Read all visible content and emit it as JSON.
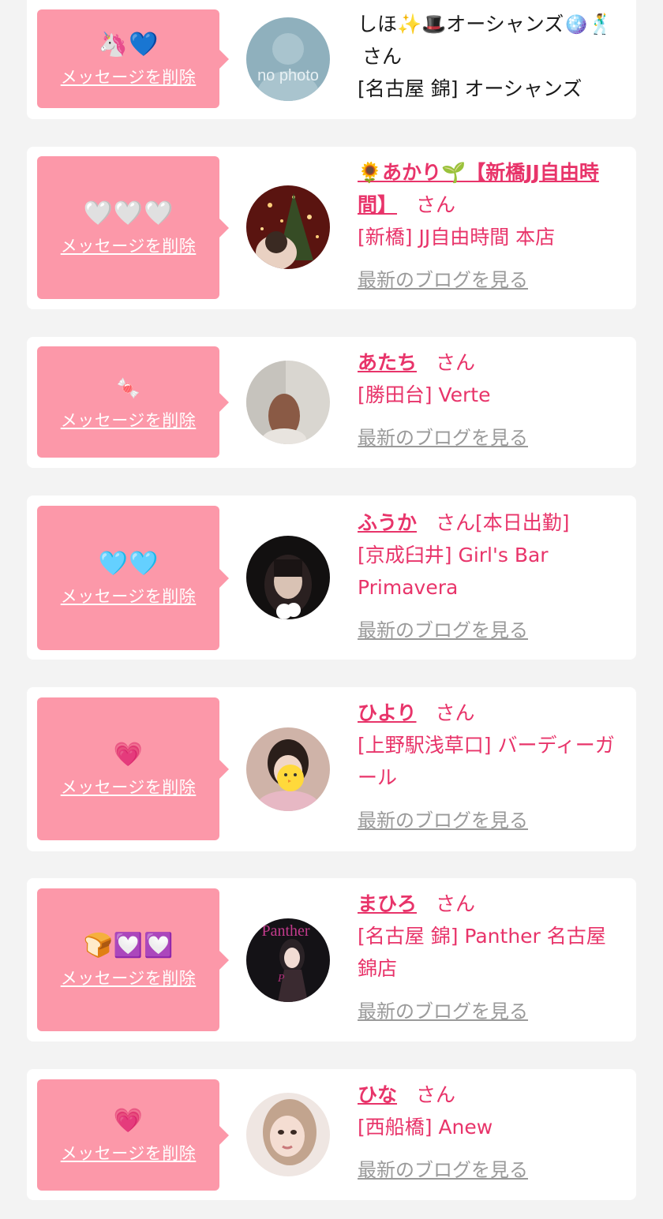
{
  "delete_label": "メッセージを削除",
  "san_label": "さん",
  "blog_label": "最新のブログを見る",
  "colors": {
    "accent": "#e8346a",
    "bubble": "#fc98a9",
    "background": "#f3f3f3"
  },
  "messages": [
    {
      "emoji": [
        "🦄",
        "💙"
      ],
      "name": "しほ✨🎩オーシャンズ🪩🕺",
      "suffix": "",
      "shop": "[名古屋 錦] オーシャンズ",
      "show_blog": false
    },
    {
      "emoji": [
        "🤍",
        "🤍",
        "🤍"
      ],
      "name": "🌻あかり🌱【新橋JJ自由時間】",
      "suffix": "",
      "shop": "[新橋] JJ自由時間 本店",
      "show_blog": true
    },
    {
      "emoji": [
        "🍬"
      ],
      "name": "あたち",
      "suffix": "",
      "shop": "[勝田台] Verte",
      "show_blog": true
    },
    {
      "emoji": [
        "🩵",
        "🩵"
      ],
      "name": "ふうか",
      "suffix": "[本日出勤]",
      "shop": "[京成臼井] Girl's Bar Primavera",
      "show_blog": true
    },
    {
      "emoji": [
        "💗"
      ],
      "name": "ひより",
      "suffix": "",
      "shop": "[上野駅浅草口] バーディーガール",
      "show_blog": true
    },
    {
      "emoji": [
        "🍞",
        "💟",
        "💟"
      ],
      "name": "まひろ",
      "suffix": "",
      "shop": "[名古屋 錦] Panther 名古屋錦店",
      "show_blog": true
    },
    {
      "emoji": [
        "💗"
      ],
      "name": "ひな",
      "suffix": "",
      "shop": "[西船橋] Anew",
      "show_blog": true
    }
  ]
}
